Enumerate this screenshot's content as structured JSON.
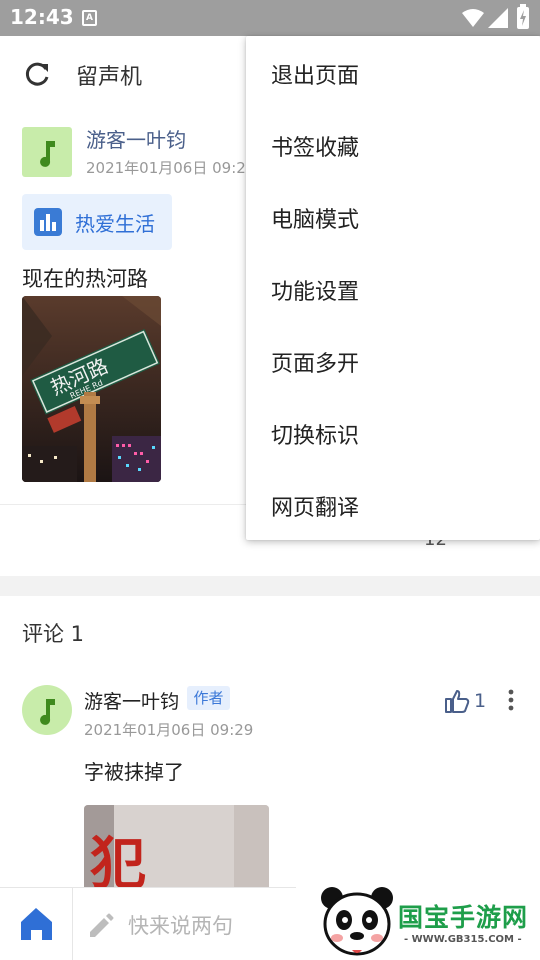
{
  "status_bar": {
    "time": "12:43",
    "notification_glyph": "A",
    "icons": [
      "wifi-icon",
      "signal-icon",
      "battery-charging-icon"
    ],
    "color": "#9e9e9e"
  },
  "app_bar": {
    "refresh_icon": "refresh-icon",
    "title": "留声机"
  },
  "post": {
    "author": "游客一叶钧",
    "date": "2021年01月06日 09:2",
    "tag_label": "热爱生活",
    "text": "现在的热河路",
    "photo_sign_text": "热河路",
    "photo_sign_sub": "REHE Rd",
    "like_count": "12"
  },
  "comments": {
    "heading": "评论 1",
    "items": [
      {
        "author": "游客一叶钧",
        "badge": "作者",
        "date": "2021年01月06日 09:29",
        "text": "字被抹掉了",
        "like_count": "1",
        "photo_char": "犯"
      }
    ]
  },
  "bottom_bar": {
    "home_icon": "home-icon",
    "placeholder": "快来说两句"
  },
  "watermark": {
    "title": "国宝手游网",
    "url": "- WWW.GB315.COM -"
  },
  "menu": {
    "items": [
      {
        "label": "退出页面"
      },
      {
        "label": "书签收藏"
      },
      {
        "label": "电脑模式"
      },
      {
        "label": "功能设置"
      },
      {
        "label": "页面多开"
      },
      {
        "label": "切换标识"
      },
      {
        "label": "网页翻译"
      }
    ]
  },
  "colors": {
    "accent": "#3a7bd5",
    "author_link": "#4a5f8a",
    "avatar_bg": "#c8ecaa",
    "avatar_note": "#3f8a1e"
  }
}
